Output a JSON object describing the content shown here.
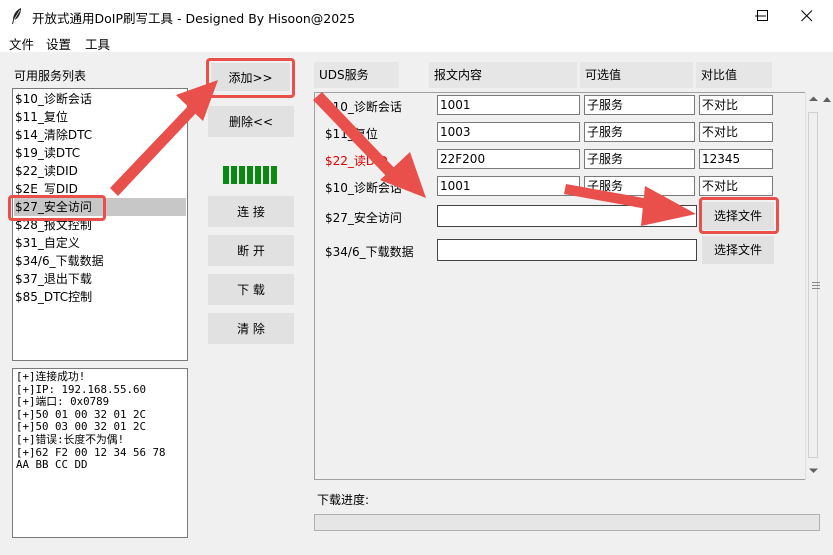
{
  "window": {
    "title": "开放式通用DoIP刷写工具 - Designed By Hisoon@2025",
    "icon": "feather-icon"
  },
  "menu": [
    "文件",
    "设置",
    "工具"
  ],
  "left": {
    "list_label": "可用服务列表",
    "services": [
      "$10_诊断会话",
      "$11_复位",
      "$14_清除DTC",
      "$19_读DTC",
      "$22_读DID",
      "$2E_写DID",
      "$27_安全访问",
      "$28_报文控制",
      "$31_自定义",
      "$34/6_下载数据",
      "$37_退出下载",
      "$85_DTC控制"
    ],
    "selected_index": 6,
    "log": [
      "[+]连接成功!",
      "[+]IP: 192.168.55.60",
      "[+]端口: 0x0789",
      "[+]50 01 00 32 01 2C",
      "[+]50 03 00 32 01 2C",
      "[+]错误:长度不为偶!",
      "[+]62 F2 00 12 34 56 78",
      "AA BB CC DD"
    ]
  },
  "middle": {
    "add_label": "添加>>",
    "remove_label": "删除<<",
    "connect_label": "连 接",
    "disconnect_label": "断 开",
    "download_label": "下 载",
    "clear_label": "清 除",
    "status_color": "#0a8a10"
  },
  "table": {
    "headers": [
      "UDS服务",
      "报文内容",
      "可选值",
      "对比值"
    ],
    "rows": [
      {
        "service": "$10_诊断会话",
        "content": "1001",
        "option": "子服务",
        "compare": "不对比"
      },
      {
        "service": "$11_复位",
        "content": "1003",
        "option": "子服务",
        "compare": "不对比"
      },
      {
        "service": "$22_读DID",
        "content": "22F200",
        "option": "子服务",
        "compare": "12345",
        "service_color": "#e00000"
      },
      {
        "service": "$10_诊断会话",
        "content": "1001",
        "option": "子服务",
        "compare": "不对比"
      },
      {
        "service": "$27_安全访问",
        "content": "",
        "file_button": "选择文件"
      },
      {
        "service": "$34/6_下载数据",
        "content": "",
        "file_button": "选择文件"
      }
    ]
  },
  "download": {
    "label": "下载进度:",
    "progress": 0
  },
  "annotation_color": "#e9504b"
}
